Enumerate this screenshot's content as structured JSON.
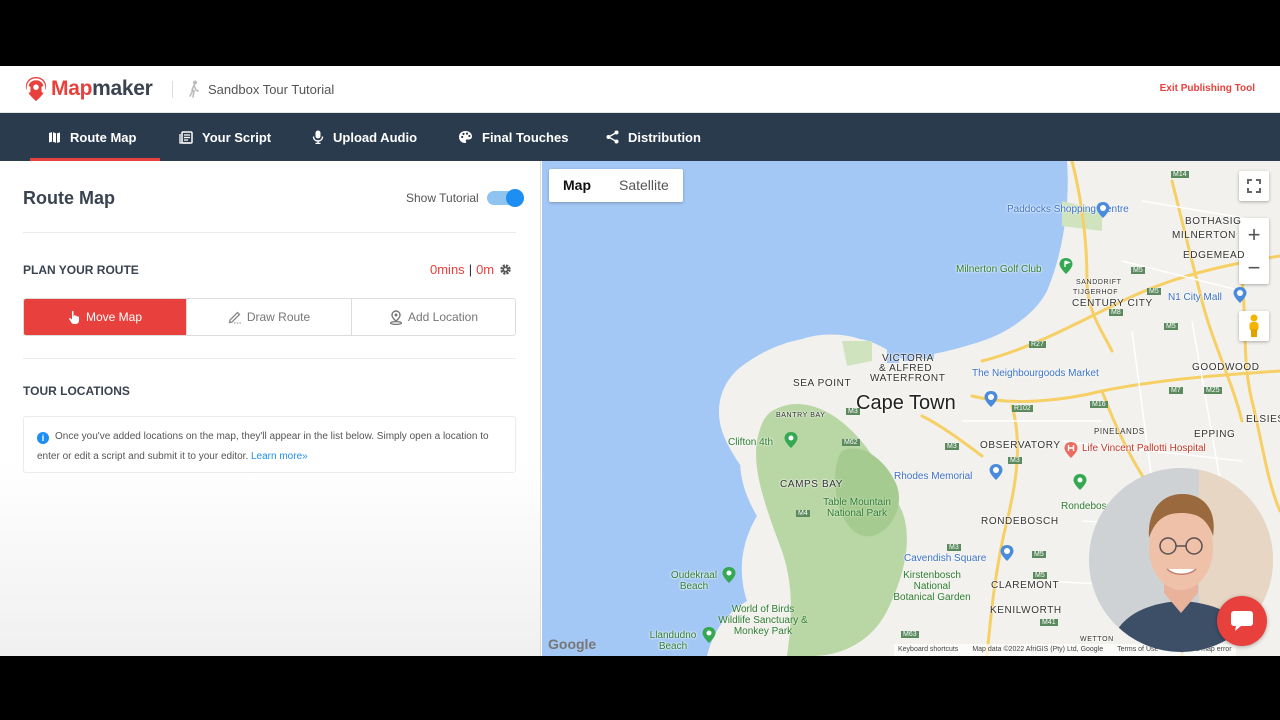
{
  "header": {
    "brand_prefix": "Map",
    "brand_suffix": "maker",
    "tour_title": "Sandbox Tour Tutorial",
    "exit_label": "Exit Publishing Tool"
  },
  "nav": {
    "items": [
      {
        "label": "Route Map",
        "icon": "map-icon",
        "active": true
      },
      {
        "label": "Your Script",
        "icon": "script-icon",
        "active": false
      },
      {
        "label": "Upload Audio",
        "icon": "microphone-icon",
        "active": false
      },
      {
        "label": "Final Touches",
        "icon": "palette-icon",
        "active": false
      },
      {
        "label": "Distribution",
        "icon": "share-icon",
        "active": false
      }
    ]
  },
  "panel": {
    "title": "Route Map",
    "tutorial_label": "Show Tutorial",
    "tutorial_on": true,
    "plan_heading": "PLAN YOUR ROUTE",
    "route_time": "0mins",
    "route_sep": "|",
    "route_distance": "0m",
    "modes": [
      {
        "label": "Move Map",
        "icon": "hand-pointer-icon",
        "active": true
      },
      {
        "label": "Draw Route",
        "icon": "pencil-icon",
        "active": false
      },
      {
        "label": "Add Location",
        "icon": "location-pin-icon",
        "active": false
      }
    ],
    "locations_heading": "TOUR LOCATIONS",
    "info_text": "Once you've added locations on the map, they'll appear in the list below. Simply open a location to enter or edit a script and submit it to your editor.",
    "learn_more": "Learn more»"
  },
  "map": {
    "type_options": [
      "Map",
      "Satellite"
    ],
    "selected_type": "Map",
    "city": "Cape Town",
    "areas": [
      "BOTHASIG",
      "MILNERTON",
      "EDGEMEAD",
      "SANDDRIFT",
      "TIJGERHOF",
      "CENTURY CITY",
      "VICTORIA",
      "& ALFRED",
      "WATERFRONT",
      "SEA POINT",
      "GOODWOOD",
      "BANTRY BAY",
      "PINELANDS",
      "EPPING",
      "ELSIES",
      "OBSERVATORY",
      "CAMPS BAY",
      "RONDEBOSCH",
      "CLAREMONT",
      "KENILWORTH",
      "WETTON"
    ],
    "pois": [
      "Paddocks Shopping Centre",
      "Milnerton Golf Club",
      "N1 City Mall",
      "The Neighbourgoods Market",
      "Clifton 4th",
      "Life Vincent Pallotti Hospital",
      "Rhodes Memorial",
      "Rondebosch",
      "Cavendish Square",
      "Oudekraal Beach",
      "Llandudno Beach"
    ],
    "parks": [
      "Table Mountain National Park",
      "Kirstenbosch National Botanical Garden",
      "World of Birds Wildlife Sanctuary & Monkey Park"
    ],
    "road_shields": [
      "M14",
      "M5",
      "M5",
      "M5",
      "M8",
      "M7",
      "M25",
      "R27",
      "R102",
      "M16",
      "M62",
      "M3",
      "M3",
      "M3",
      "M5",
      "M5",
      "M63",
      "M41",
      "M4",
      "M3"
    ],
    "google": "Google",
    "footer": [
      "Keyboard shortcuts",
      "Map data ©2022 AfriGIS (Pty) Ltd, Google",
      "Terms of Use",
      "Report a map error"
    ]
  },
  "colors": {
    "brand_red": "#e8413d",
    "nav_bg": "#2a3b4d",
    "accent_blue": "#1d8ef2",
    "water": "#a4c8f5"
  }
}
